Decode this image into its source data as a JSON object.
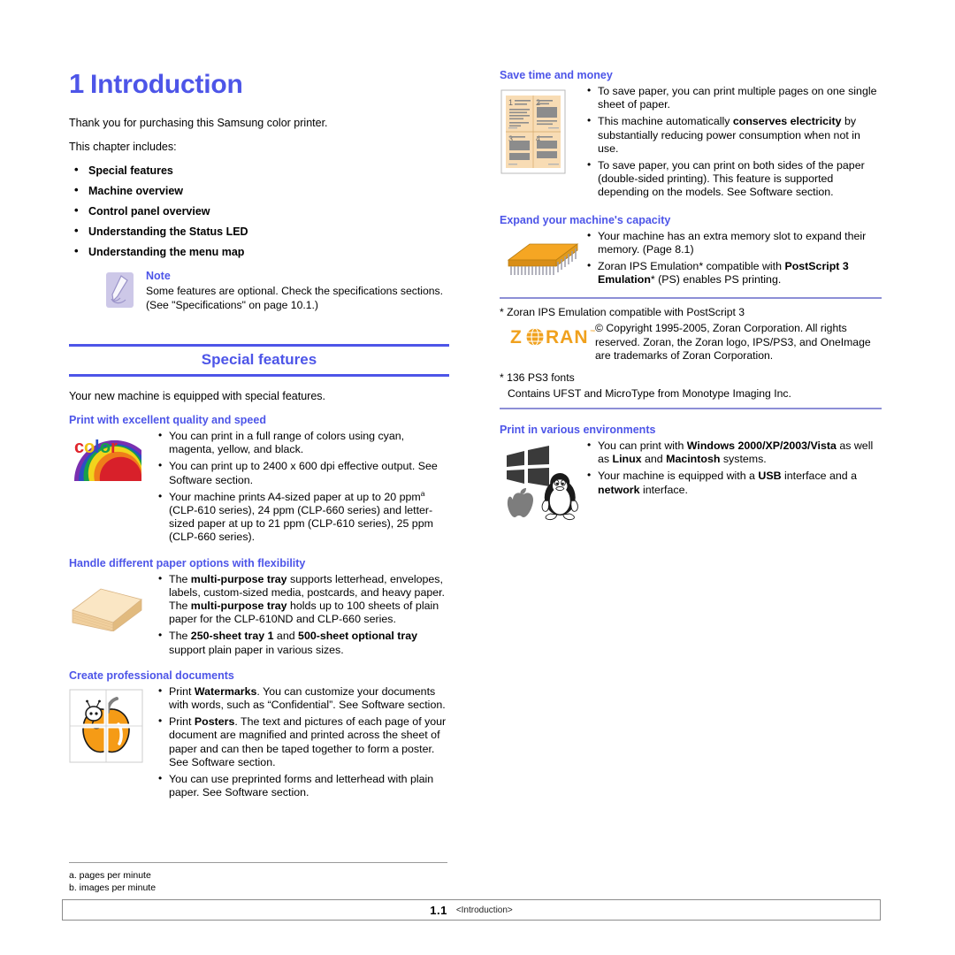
{
  "chapter": {
    "number": "1",
    "title": "Introduction",
    "intro": "Thank you for purchasing this Samsung color printer.",
    "includes_label": "This chapter includes:",
    "includes": [
      "Special features",
      "Machine overview",
      "Control panel overview",
      "Understanding the Status LED",
      "Understanding the menu map"
    ]
  },
  "note": {
    "title": "Note",
    "text": "Some features are optional. Check the specifications sections. (See \"Specifications\" on page 10.1.)",
    "icon": "note-pen-icon"
  },
  "special_features": {
    "heading": "Special features",
    "intro": "Your new machine is equipped with special features."
  },
  "sections": {
    "quality": {
      "heading": "Print with excellent quality and speed",
      "icon": "color-rainbow-icon",
      "bullets": [
        "You can print in a full range of colors using cyan, magenta, yellow, and black.",
        "You can print up to 2400 x 600 dpi effective output. See Software section.",
        "Your machine prints A4-sized paper at up to 20 ppm"
      ],
      "bullet3_sup": "a",
      "bullet3_rest": " (CLP-610 series), 24 ppm (CLP-660 series) and letter-sized paper at up to 21 ppm (CLP-610 series), 25 ppm (CLP-660 series)."
    },
    "paper": {
      "heading": "Handle different paper options with flexibility",
      "icon": "paper-stack-icon",
      "b1_p1": "The ",
      "b1_b1": "multi-purpose tray",
      "b1_p2": " supports letterhead, envelopes, labels, custom-sized media, postcards, and heavy paper. The ",
      "b1_b2": "multi-purpose tray",
      "b1_p3": " holds up to 100 sheets of plain paper for the CLP-610ND and CLP-660 series.",
      "b2_p1": "The ",
      "b2_b1": "250-sheet tray 1",
      "b2_p2": " and ",
      "b2_b2": "500-sheet optional tray",
      "b2_p3": " support plain paper in various sizes."
    },
    "documents": {
      "heading": "Create professional documents",
      "icon": "poster-apple-icon",
      "b1_p1": "Print ",
      "b1_b1": "Watermarks",
      "b1_p2": ". You can customize your documents with words, such as “Confidential”. See Software section.",
      "b2_p1": "Print ",
      "b2_b1": "Posters",
      "b2_p2": ". The text and pictures of each page of your document are magnified and printed across the sheet of paper and can then be taped together to form a poster. See Software section.",
      "b3": "You can use preprinted forms and letterhead with plain paper. See Software section."
    },
    "save": {
      "heading": "Save time and money",
      "icon": "n-up-pages-icon",
      "b1": "To save paper, you can print multiple pages on one single sheet of paper.",
      "b2_p1": "This machine automatically ",
      "b2_b1": "conserves electricity",
      "b2_p2": " by substantially reducing power consumption when not in use.",
      "b3": "To save paper, you can print on both sides of the paper (double-sided printing). This feature is supported depending on the models. See Software section."
    },
    "capacity": {
      "heading": "Expand your machine's capacity",
      "icon": "memory-module-icon",
      "b1": "Your machine has an extra memory slot to expand their memory. (Page 8.1)",
      "b2_p1": "Zoran IPS Emulation* compatible with ",
      "b2_b1": "PostScript 3 Emulation",
      "b2_p2": "* (PS) enables PS printing."
    },
    "zoran": {
      "star_line1": "* Zoran IPS Emulation compatible with PostScript 3",
      "logo": "zoran-logo",
      "logo_text": "Z⊕RAN",
      "copyright": "© Copyright 1995-2005, Zoran Corporation. All rights reserved. Zoran, the Zoran logo, IPS/PS3, and OneImage are trademarks of Zoran Corporation.",
      "star_line2": "* 136 PS3 fonts",
      "fonts_line": "Contains UFST and MicroType from Monotype Imaging Inc."
    },
    "environments": {
      "heading": "Print in various environments",
      "icon": "os-logos-icon",
      "b1_p1": "You can print with ",
      "b1_b1": "Windows 2000/XP/2003/Vista",
      "b1_p2": " as well as ",
      "b1_b2": "Linux",
      "b1_p3": " and ",
      "b1_b3": "Macintosh",
      "b1_p4": " systems.",
      "b2_p1": "Your machine is equipped with a ",
      "b2_b1": "USB",
      "b2_p2": " interface and a ",
      "b2_b2": "network",
      "b2_p3": " interface."
    }
  },
  "footnotes": [
    "a. pages per minute",
    "b. images per minute"
  ],
  "footer": {
    "page": "1.1",
    "section": "<Introduction>"
  },
  "colors": {
    "accent_blue": "#4d55e8",
    "rule_blue": "#8d8fd6",
    "note_bg": "#cdc8e8",
    "zoran_orange": "#f0a11e",
    "paper_tan": "#f6dcb0",
    "apple_orange": "#f59b16"
  }
}
